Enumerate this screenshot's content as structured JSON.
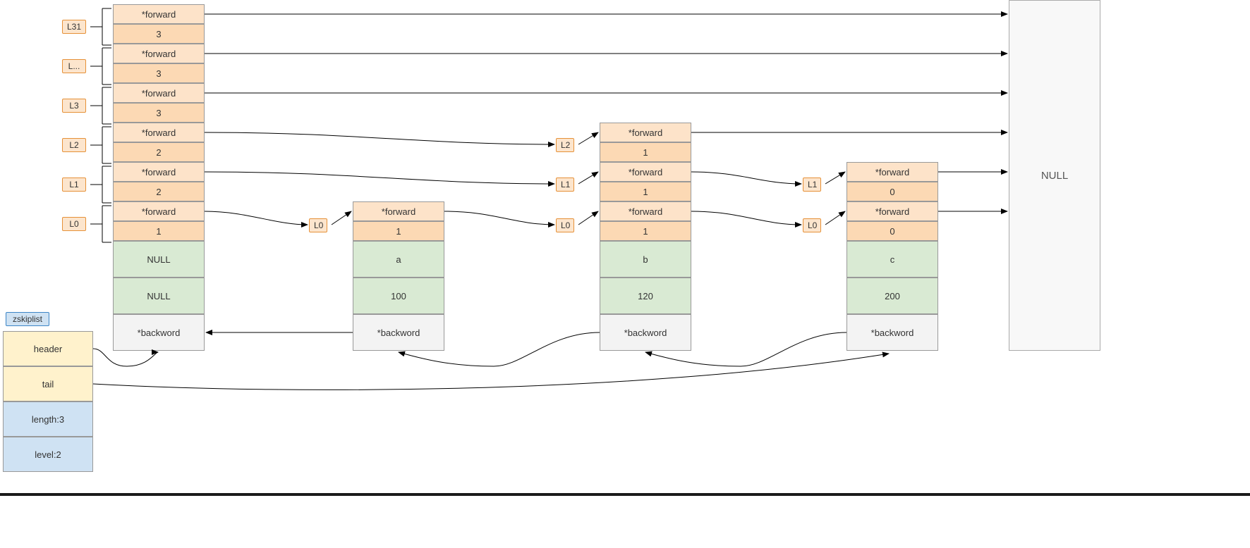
{
  "levelLabels": [
    "L31",
    "L...",
    "L3",
    "L2",
    "L1",
    "L0"
  ],
  "headerNode": {
    "levels": [
      {
        "forward": "*forward",
        "span": "3"
      },
      {
        "forward": "*forward",
        "span": "3"
      },
      {
        "forward": "*forward",
        "span": "3"
      },
      {
        "forward": "*forward",
        "span": "2"
      },
      {
        "forward": "*forward",
        "span": "2"
      },
      {
        "forward": "*forward",
        "span": "1"
      }
    ],
    "obj": "NULL",
    "score": "NULL",
    "backward": "*backword"
  },
  "nodeA": {
    "levels": [
      {
        "forward": "*forward",
        "span": "1"
      }
    ],
    "obj": "a",
    "score": "100",
    "backward": "*backword"
  },
  "nodeB": {
    "levels": [
      {
        "forward": "*forward",
        "span": "1"
      },
      {
        "forward": "*forward",
        "span": "1"
      },
      {
        "forward": "*forward",
        "span": "1"
      }
    ],
    "obj": "b",
    "score": "120",
    "backward": "*backword"
  },
  "nodeC": {
    "levels": [
      {
        "forward": "*forward",
        "span": "0"
      },
      {
        "forward": "*forward",
        "span": "0"
      }
    ],
    "obj": "c",
    "score": "200",
    "backward": "*backword"
  },
  "midLabels": {
    "L2b": "L2",
    "L1b": "L1",
    "L0a": "L0",
    "L0b": "L0",
    "L1c": "L1",
    "L0c": "L0"
  },
  "nullBox": "NULL",
  "zskiplist": {
    "title": "zskiplist",
    "header": "header",
    "tail": "tail",
    "length": "length:3",
    "level": "level:2"
  }
}
